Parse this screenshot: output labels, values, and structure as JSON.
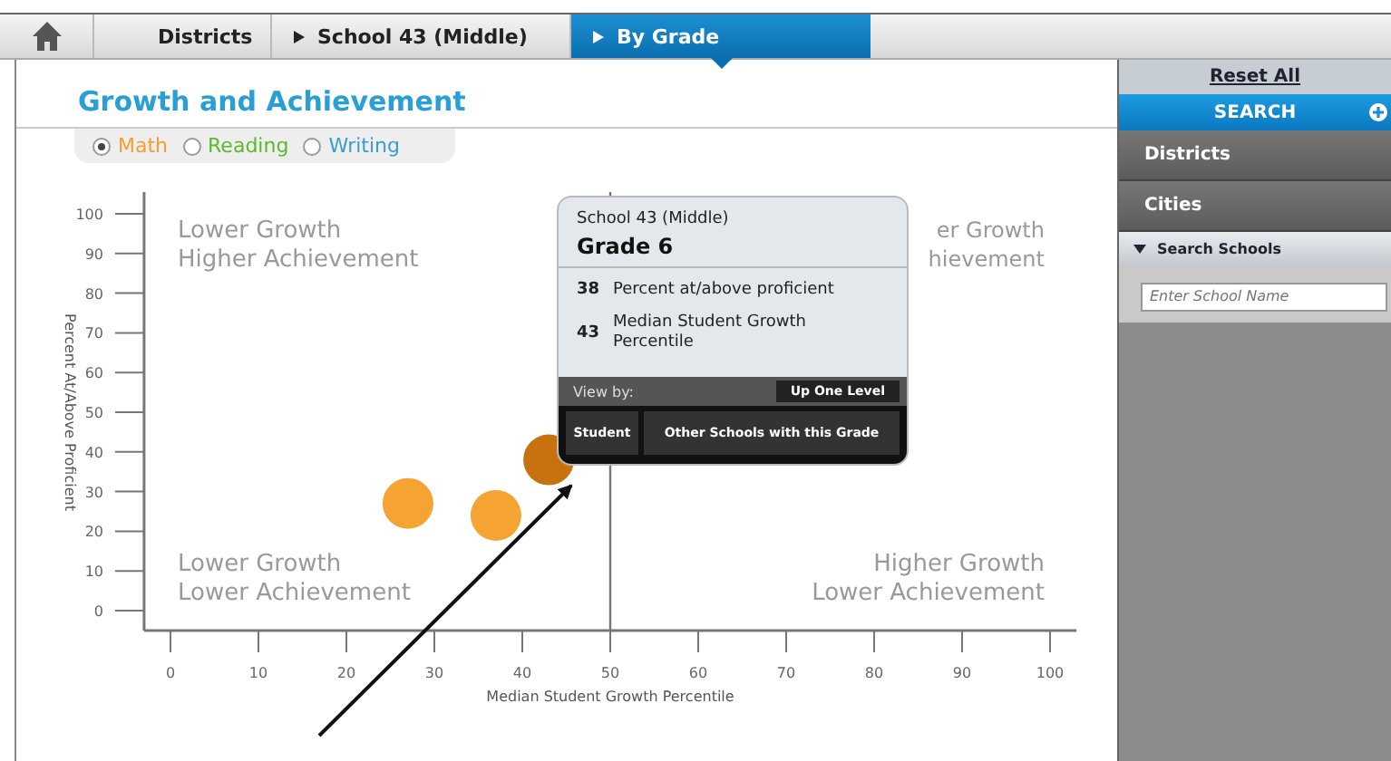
{
  "breadcrumbs": [
    {
      "kind": "home",
      "selected": false
    },
    {
      "kind": "link",
      "label": "Districts",
      "selected": false
    },
    {
      "kind": "arrow",
      "label": "School 43 (Middle)",
      "selected": false
    },
    {
      "kind": "arrow",
      "label": "By Grade",
      "selected": true
    }
  ],
  "title": "Growth and Achievement",
  "subjects": [
    {
      "label": "Math",
      "selected": true,
      "color": "#f0a030"
    },
    {
      "label": "Reading",
      "selected": false,
      "color": "#5cb82e"
    },
    {
      "label": "Writing",
      "selected": false,
      "color": "#3a9fc8"
    }
  ],
  "chart": {
    "quadrants": [
      {
        "lines": [
          "Lower Growth",
          "Higher Achievement"
        ]
      },
      {
        "lines": [
          "er Growth",
          "hievement"
        ]
      },
      {
        "lines": [
          "Lower Growth",
          "Lower Achievement"
        ]
      },
      {
        "lines": [
          "Higher Growth",
          "Lower Achievement"
        ]
      }
    ],
    "chart_data": {
      "type": "scatter",
      "xlabel": "Median Student Growth Percentile",
      "ylabel": "Percent At/Above Proficient",
      "xlim": [
        -3,
        103
      ],
      "ylim": [
        0,
        100
      ],
      "xticks": [
        0,
        10,
        20,
        30,
        40,
        50,
        60,
        70,
        80,
        90,
        100
      ],
      "yticks": [
        0,
        10,
        20,
        30,
        40,
        50,
        60,
        70,
        80,
        90,
        100
      ],
      "series": [
        {
          "color": "#f5a333",
          "x": [
            27,
            37
          ],
          "values": [
            27,
            24
          ]
        },
        {
          "color": "#c8720f",
          "x": [
            43
          ],
          "values": [
            38
          ]
        }
      ]
    }
  },
  "tooltip": {
    "school": "School 43 (Middle)",
    "grade": "Grade 6",
    "stats": [
      {
        "value": "38",
        "label": "Percent at/above proficient"
      },
      {
        "value": "43",
        "label": "Median Student Growth Percentile"
      }
    ],
    "view_by": "View by:",
    "up_button": "Up One Level",
    "buttons": [
      "Student",
      "Other Schools with this Grade"
    ]
  },
  "sidebar": {
    "reset": "Reset All",
    "search": "SEARCH",
    "items": [
      {
        "label": "Districts",
        "expanded": false
      },
      {
        "label": "Cities",
        "expanded": false
      },
      {
        "label": "Search Schools",
        "expanded": true
      }
    ],
    "placeholder": "Enter School Name"
  }
}
